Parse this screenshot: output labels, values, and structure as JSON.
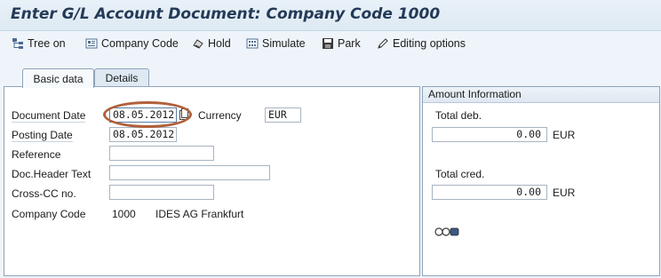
{
  "title": "Enter G/L Account Document: Company Code 1000",
  "toolbar": {
    "tree_on": "Tree on",
    "company_code": "Company Code",
    "hold": "Hold",
    "simulate": "Simulate",
    "park": "Park",
    "editing_options": "Editing options"
  },
  "tabs": [
    {
      "label": "Basic data",
      "active": true
    },
    {
      "label": "Details",
      "active": false
    }
  ],
  "form": {
    "document_date": {
      "label": "Document Date",
      "value": "08.05.2012"
    },
    "currency": {
      "label": "Currency",
      "value": "EUR"
    },
    "posting_date": {
      "label": "Posting Date",
      "value": "08.05.2012"
    },
    "reference": {
      "label": "Reference",
      "value": ""
    },
    "doc_header_text": {
      "label": "Doc.Header Text",
      "value": ""
    },
    "cross_cc_no": {
      "label": "Cross-CC no.",
      "value": ""
    },
    "company_code": {
      "label": "Company Code",
      "code": "1000",
      "name": "IDES AG Frankfurt"
    }
  },
  "amount_info": {
    "heading": "Amount Information",
    "total_deb_label": "Total deb.",
    "total_deb_value": "0.00",
    "total_deb_currency": "EUR",
    "total_cred_label": "Total cred.",
    "total_cred_value": "0.00",
    "total_cred_currency": "EUR"
  },
  "icons": {
    "tree_on": "tree-icon",
    "company_code": "company-code-icon",
    "hold": "hold-icon",
    "simulate": "simulate-icon",
    "park": "park-icon",
    "editing_options": "pencil-icon",
    "calendar": "calendar-icon",
    "status_lights": "traffic-light-icon"
  },
  "colors": {
    "highlight_ellipse": "#b0603a",
    "title_text": "#243a57",
    "status_red": "#c8281e",
    "status_gray": "#b9b9b9"
  }
}
